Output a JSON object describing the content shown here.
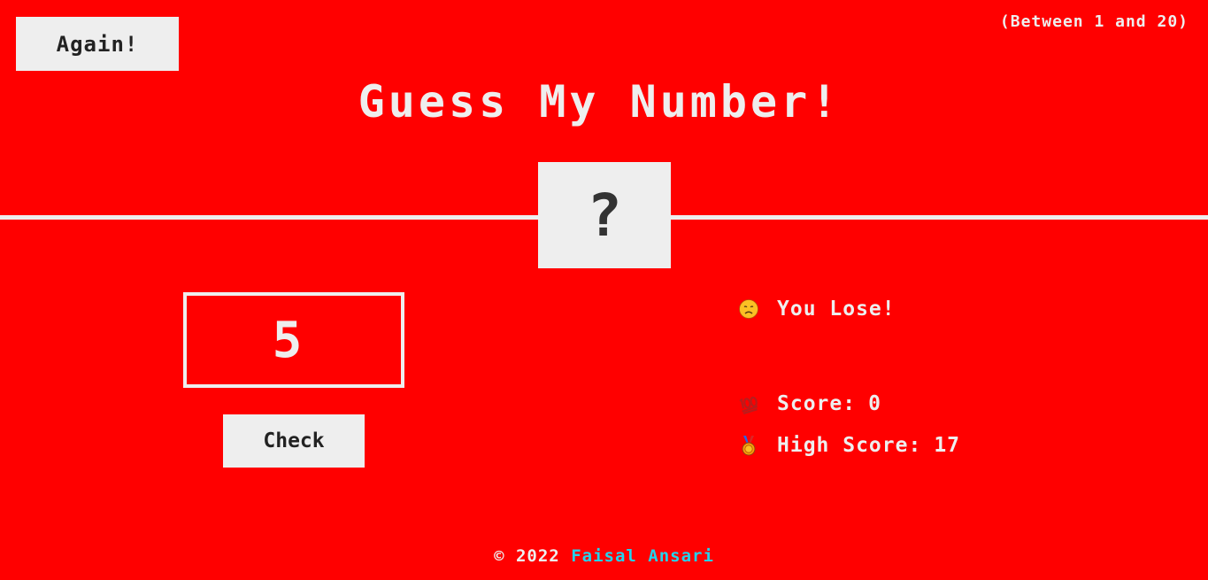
{
  "header": {
    "again_label": "Again!",
    "range_hint": "(Between 1 and 20)",
    "title": "Guess My Number!"
  },
  "secret": {
    "display": "?"
  },
  "guess": {
    "value": "5"
  },
  "controls": {
    "check_label": "Check"
  },
  "stats": {
    "message": "You Lose!",
    "message_icon": "disappointed-face-icon",
    "score_label": "Score:",
    "score_value": "0",
    "score_icon": "hundred-points-icon",
    "high_score_label": "High Score:",
    "high_score_value": "17",
    "high_score_icon": "medal-icon"
  },
  "footer": {
    "copyright": "© 2022",
    "author": "Faisal Ansari"
  },
  "colors": {
    "background": "#ff0000",
    "foreground": "#eeeeee",
    "button_text": "#222222",
    "author_link": "#22d3ee"
  }
}
